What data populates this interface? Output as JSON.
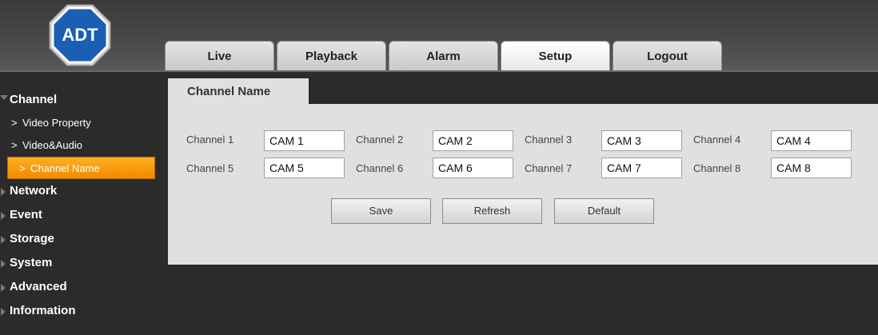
{
  "brand": {
    "logo_text": "ADT"
  },
  "nav": {
    "tabs": [
      {
        "label": "Live"
      },
      {
        "label": "Playback"
      },
      {
        "label": "Alarm"
      },
      {
        "label": "Setup",
        "active": true
      },
      {
        "label": "Logout"
      }
    ]
  },
  "sidebar": {
    "channel": {
      "label": "Channel",
      "items": [
        {
          "label": "Video Property"
        },
        {
          "label": "Video&Audio"
        },
        {
          "label": "Channel Name",
          "active": true
        }
      ]
    },
    "categories": [
      "Network",
      "Event",
      "Storage",
      "System",
      "Advanced",
      "Information"
    ]
  },
  "content": {
    "tab_label": "Channel Name",
    "channels": [
      {
        "label": "Channel 1",
        "value": "CAM 1"
      },
      {
        "label": "Channel 2",
        "value": "CAM 2"
      },
      {
        "label": "Channel 3",
        "value": "CAM 3"
      },
      {
        "label": "Channel 4",
        "value": "CAM 4"
      },
      {
        "label": "Channel 5",
        "value": "CAM 5"
      },
      {
        "label": "Channel 6",
        "value": "CAM 6"
      },
      {
        "label": "Channel 7",
        "value": "CAM 7"
      },
      {
        "label": "Channel 8",
        "value": "CAM 8"
      }
    ],
    "buttons": {
      "save": "Save",
      "refresh": "Refresh",
      "default": "Default"
    }
  },
  "colors": {
    "accent": "#f59a10",
    "background": "#2b2b2b",
    "panel": "#e0e0e0",
    "logo_blue": "#1a5fb4"
  }
}
